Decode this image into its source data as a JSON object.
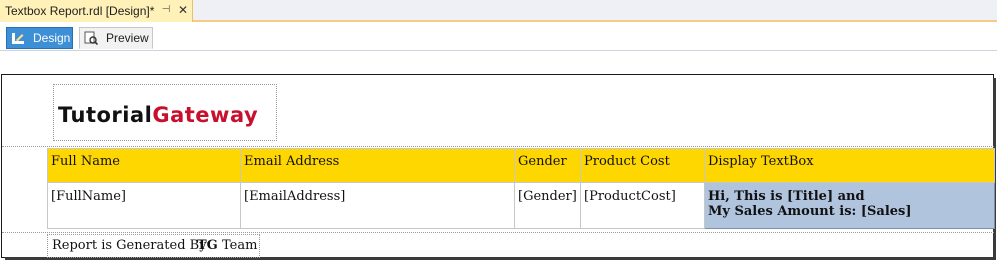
{
  "document_tab": {
    "title": "Textbox Report.rdl [Design]*",
    "pin_icon": "pin-icon",
    "close_icon": "close-icon"
  },
  "view_tabs": [
    {
      "label": "Design",
      "icon": "design-icon",
      "active": true
    },
    {
      "label": "Preview",
      "icon": "preview-icon",
      "active": false
    }
  ],
  "logo": {
    "part1": "Tutorial",
    "part2": "Gateway",
    "color1": "#111111",
    "color2": "#c8102e"
  },
  "table": {
    "headers": [
      "Full Name",
      "Email Address",
      "Gender",
      "Product Cost",
      "Display TextBox"
    ],
    "row": [
      "[FullName]",
      "[EmailAddress]",
      "[Gender]",
      "[ProductCost]"
    ],
    "display_line1": "Hi, This is [Title] and",
    "display_line2": "My Sales Amount is: [Sales]",
    "header_color": "#ffd700",
    "highlight_color": "#b0c4de"
  },
  "footer": {
    "prefix": "Report is Generated By",
    "bold": "TG",
    "suffix": "Team"
  }
}
